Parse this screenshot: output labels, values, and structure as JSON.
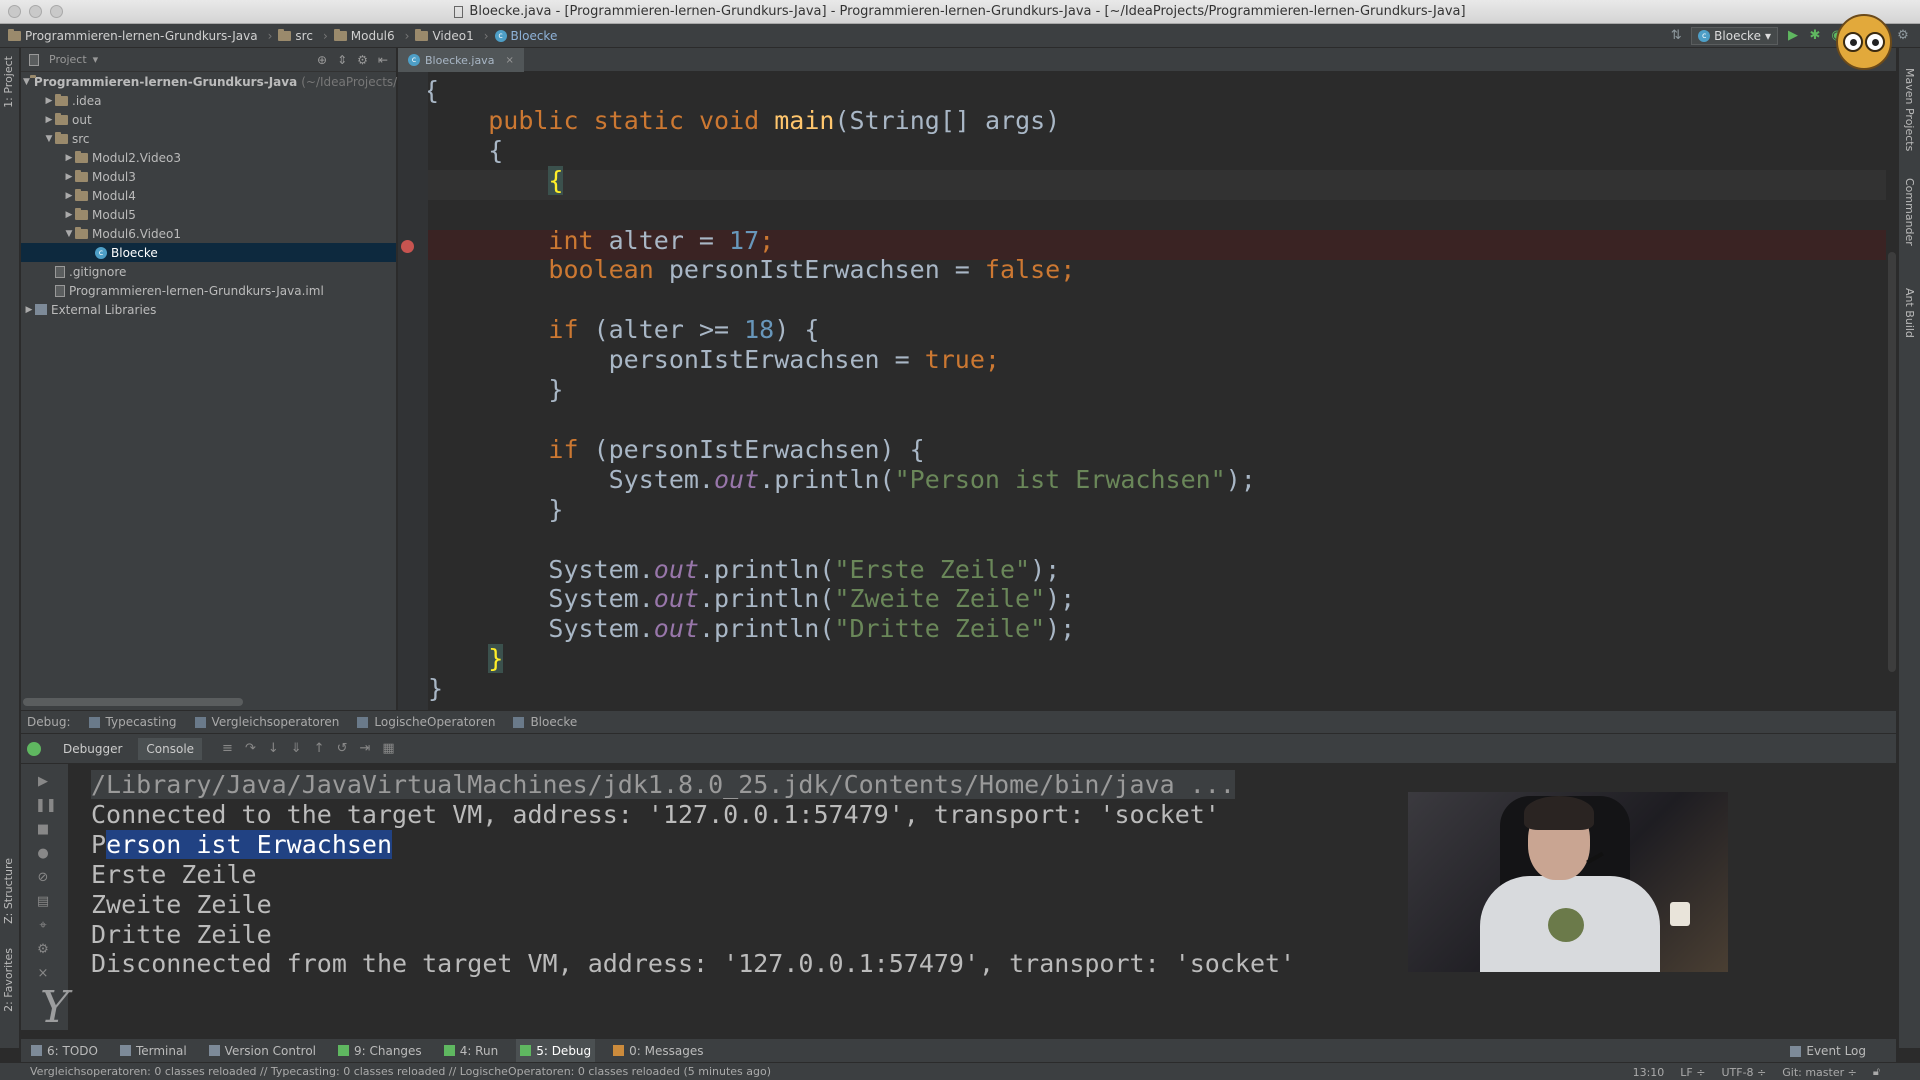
{
  "window": {
    "title": "Bloecke.java - [Programmieren-lernen-Grundkurs-Java] - Programmieren-lernen-Grundkurs-Java - [~/IdeaProjects/Programmieren-lernen-Grundkurs-Java]"
  },
  "breadcrumbs": [
    "Programmieren-lernen-Grundkurs-Java",
    "src",
    "Modul6",
    "Video1",
    "Bloecke"
  ],
  "toolbar": {
    "run_config": "Bloecke",
    "run_icon": "play-icon",
    "debug_icon": "bug-icon"
  },
  "side_tabs": {
    "left_top": "1: Project",
    "left_structure": "Z: Structure",
    "left_favorites": "2: Favorites",
    "right_maven": "Maven Projects",
    "right_commander": "Commander",
    "right_ant": "Ant Build"
  },
  "project_panel": {
    "header": "Project",
    "root_name": "Programmieren-lernen-Grundkurs-Java",
    "root_path": "(~/IdeaProjects/",
    "items": [
      {
        "label": ".idea",
        "indent": 1,
        "arrow": "▶",
        "type": "folder"
      },
      {
        "label": "out",
        "indent": 1,
        "arrow": "▶",
        "type": "folder"
      },
      {
        "label": "src",
        "indent": 1,
        "arrow": "▼",
        "type": "folder"
      },
      {
        "label": "Modul2.Video3",
        "indent": 2,
        "arrow": "▶",
        "type": "folder"
      },
      {
        "label": "Modul3",
        "indent": 2,
        "arrow": "▶",
        "type": "folder"
      },
      {
        "label": "Modul4",
        "indent": 2,
        "arrow": "▶",
        "type": "folder"
      },
      {
        "label": "Modul5",
        "indent": 2,
        "arrow": "▶",
        "type": "folder"
      },
      {
        "label": "Modul6.Video1",
        "indent": 2,
        "arrow": "▼",
        "type": "folder"
      },
      {
        "label": "Bloecke",
        "indent": 3,
        "arrow": "",
        "type": "class",
        "selected": true
      },
      {
        "label": ".gitignore",
        "indent": 1,
        "arrow": "",
        "type": "file"
      },
      {
        "label": "Programmieren-lernen-Grundkurs-Java.iml",
        "indent": 1,
        "arrow": "",
        "type": "file"
      },
      {
        "label": "External Libraries",
        "indent": 0,
        "arrow": "▶",
        "type": "library"
      }
    ]
  },
  "editor": {
    "tab_label": "Bloecke.java",
    "code": {
      "l1": "{",
      "l2_kw1": "public",
      "l2_kw2": "static",
      "l2_kw3": "void",
      "l2_fn": "main",
      "l2_rest": "(String[] args)",
      "l3": "{",
      "l4": "{",
      "l6_kw": "int",
      "l6_mid": " alter = ",
      "l6_num": "17",
      "l6_end": ";",
      "l7_kw": "boolean",
      "l7_mid": " personIstErwachsen = ",
      "l7_val": "false",
      "l7_end": ";",
      "l9_kw": "if",
      "l9_mid": " (alter >= ",
      "l9_num": "18",
      "l9_end": ") {",
      "l10_mid": "personIstErwachsen = ",
      "l10_val": "true",
      "l10_end": ";",
      "l11": "}",
      "l13_kw": "if",
      "l13_rest": " (personIstErwachsen) {",
      "l14_a": "System.",
      "l14_fld": "out",
      "l14_b": ".println(",
      "l14_str": "\"Person ist Erwachsen\"",
      "l14_end": ");",
      "l15": "}",
      "l17_a": "System.",
      "l17_fld": "out",
      "l17_b": ".println(",
      "l17_str": "\"Erste Zeile\"",
      "l17_end": ");",
      "l18_a": "System.",
      "l18_fld": "out",
      "l18_b": ".println(",
      "l18_str": "\"Zweite Zeile\"",
      "l18_end": ");",
      "l19_a": "System.",
      "l19_fld": "out",
      "l19_b": ".println(",
      "l19_str": "\"Dritte Zeile\"",
      "l19_end": ");",
      "l20": "}",
      "l21": "}"
    }
  },
  "debug": {
    "label": "Debug:",
    "sessions": [
      "Typecasting",
      "Vergleichsoperatoren",
      "LogischeOperatoren",
      "Bloecke"
    ],
    "tabs": [
      "Debugger",
      "Console"
    ],
    "console": {
      "path": "/Library/Java/JavaVirtualMachines/jdk1.8.0_25.jdk/Contents/Home/bin/java ...",
      "connected": "Connected to the target VM, address: '127.0.0.1:57479', transport: 'socket'",
      "line3_plain": "P",
      "line3_selected": "erson ist Erwachsen",
      "line4": "Erste Zeile",
      "line5": "Zweite Zeile",
      "line6": "Dritte Zeile",
      "disconnected": "Disconnected from the target VM, address: '127.0.0.1:57479', transport: 'socket'"
    }
  },
  "bottom_tools": [
    {
      "label": "6: TODO",
      "icon": "todo-icon"
    },
    {
      "label": "Terminal",
      "icon": "terminal-icon"
    },
    {
      "label": "Version Control",
      "icon": "vcs-icon"
    },
    {
      "label": "9: Changes",
      "icon": "changes-icon"
    },
    {
      "label": "4: Run",
      "icon": "run-icon"
    },
    {
      "label": "5: Debug",
      "icon": "debug-icon",
      "active": true
    },
    {
      "label": "0: Messages",
      "icon": "messages-icon"
    }
  ],
  "event_log": "Event Log",
  "status_bar": {
    "message": "Vergleichsoperatoren: 0 classes reloaded // Typecasting: 0 classes reloaded // LogischeOperatoren: 0 classes reloaded (5 minutes ago)",
    "position": "13:10",
    "line_sep": "LF ÷",
    "encoding": "UTF-8 ÷",
    "git": "Git: master ÷"
  },
  "logo_mark": "Y"
}
